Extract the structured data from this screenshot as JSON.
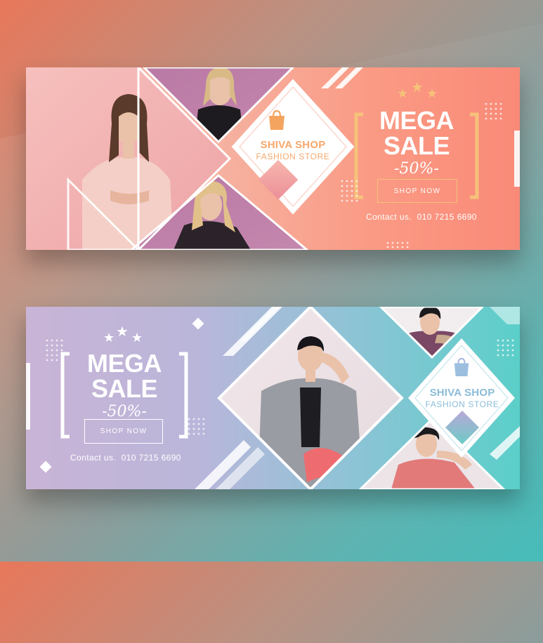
{
  "banners": [
    {
      "brand": {
        "name": "SHIVA SHOP",
        "subtitle": "FASHION STORE"
      },
      "headline": {
        "line1": "MEGA",
        "line2": "SALE",
        "discount": "-50%-"
      },
      "button_label": "SHOP NOW",
      "contact_label": "Contact us.",
      "phone": "010 7215 6690",
      "colors": {
        "accent": "#f5a45f",
        "brand_text": "#f6a86c",
        "gradient_start": "#f2b9b6",
        "gradient_end": "#f98a78"
      },
      "icons": [
        "star-icon",
        "shopping-bag-icon"
      ]
    },
    {
      "brand": {
        "name": "SHIVA SHOP",
        "subtitle": "FASHION STORE"
      },
      "headline": {
        "line1": "MEGA",
        "line2": "SALE",
        "discount": "-50%-"
      },
      "button_label": "SHOP NOW",
      "contact_label": "Contact us.",
      "phone": "010 7215 6690",
      "colors": {
        "accent": "#7ec4d8",
        "brand_text": "#8bbcd8",
        "gradient_start": "#c9b4d6",
        "gradient_end": "#5bcfc9"
      },
      "icons": [
        "star-icon",
        "shopping-bag-icon"
      ]
    }
  ]
}
